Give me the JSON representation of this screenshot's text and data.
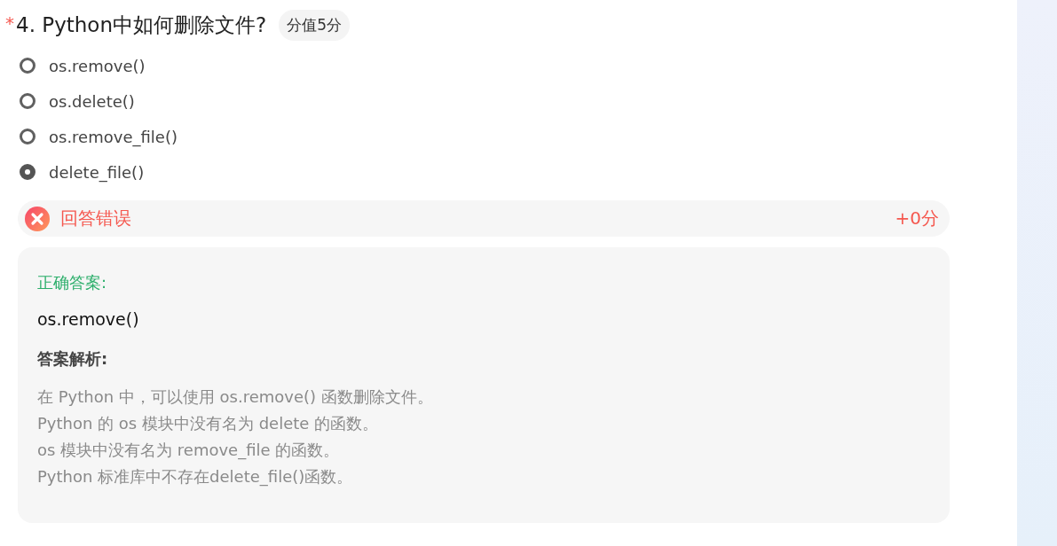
{
  "question": {
    "required_mark": "*",
    "title": "4. Python中如何删除文件?",
    "score_badge": "分值5分"
  },
  "options": [
    {
      "label": "os.remove()",
      "selected": false
    },
    {
      "label": "os.delete()",
      "selected": false
    },
    {
      "label": "os.remove_file()",
      "selected": false
    },
    {
      "label": "delete_file()",
      "selected": true
    }
  ],
  "result": {
    "kind": "wrong",
    "text": "回答错误",
    "score": "+0分"
  },
  "answer_card": {
    "correct_label": "正确答案:",
    "correct_answer": "os.remove()",
    "analysis_label": "答案解析:",
    "analysis_lines": [
      "在 Python 中，可以使用 os.remove() 函数删除文件。",
      "Python 的 os 模块中没有名为 delete 的函数。",
      "os 模块中没有名为 remove_file 的函数。",
      "Python 标准库中不存在delete_file()函数。"
    ]
  }
}
